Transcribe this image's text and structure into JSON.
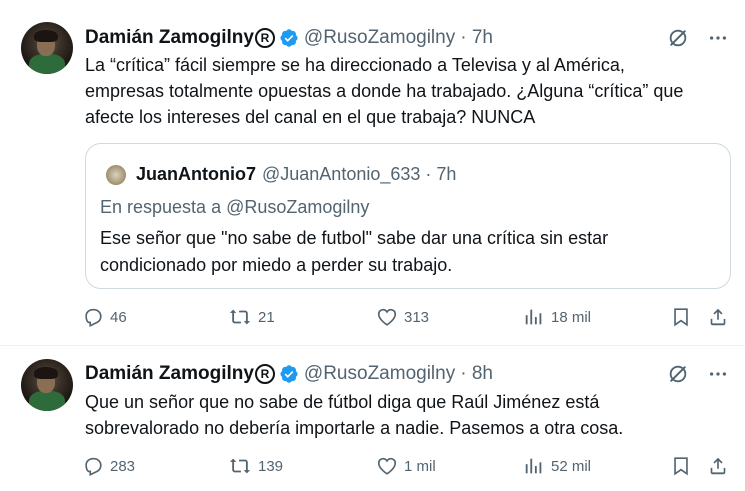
{
  "tweets": [
    {
      "author": {
        "name": "Damián Zamogilny",
        "handle": "@RusoZamogilny",
        "time": "· 7h",
        "reg_symbol": "R"
      },
      "text_lines": [
        "La “crítica” fácil siempre se ha direccionado a Televisa y al América,",
        "empresas totalmente opuestas a donde ha trabajado. ¿Alguna “crítica” que",
        "afecte los intereses del canal en el que trabaja? NUNCA"
      ],
      "quote": {
        "name": "JuanAntonio7",
        "handle": "@JuanAntonio_633 · 7h",
        "reply_to": "En respuesta a @RusoZamogilny",
        "text_lines": [
          "Ese señor que \"no sabe de futbol\" sabe dar una crítica sin estar",
          "condicionado por miedo a perder su trabajo."
        ]
      },
      "actions": {
        "replies": "46",
        "retweets": "21",
        "likes": "313",
        "views": "18 mil"
      }
    },
    {
      "author": {
        "name": "Damián Zamogilny",
        "handle": "@RusoZamogilny",
        "time": "· 8h",
        "reg_symbol": "R"
      },
      "text_lines": [
        "Que un señor que no sabe de fútbol diga que Raúl Jiménez está",
        "sobrevalorado no debería importarle a nadie. Pasemos a otra cosa."
      ],
      "actions": {
        "replies": "283",
        "retweets": "139",
        "likes": "1 mil",
        "views": "52 mil"
      }
    }
  ],
  "icons": {
    "verified": "verified-badge-icon",
    "grok": "grok-icon",
    "more": "more-icon",
    "reply": "reply-icon",
    "retweet": "retweet-icon",
    "like": "heart-icon",
    "views": "views-icon",
    "bookmark": "bookmark-icon",
    "share": "share-icon"
  },
  "colors": {
    "accent": "#1d9bf0",
    "text": "#0f1419",
    "muted": "#536471",
    "border": "#cfd9de"
  }
}
